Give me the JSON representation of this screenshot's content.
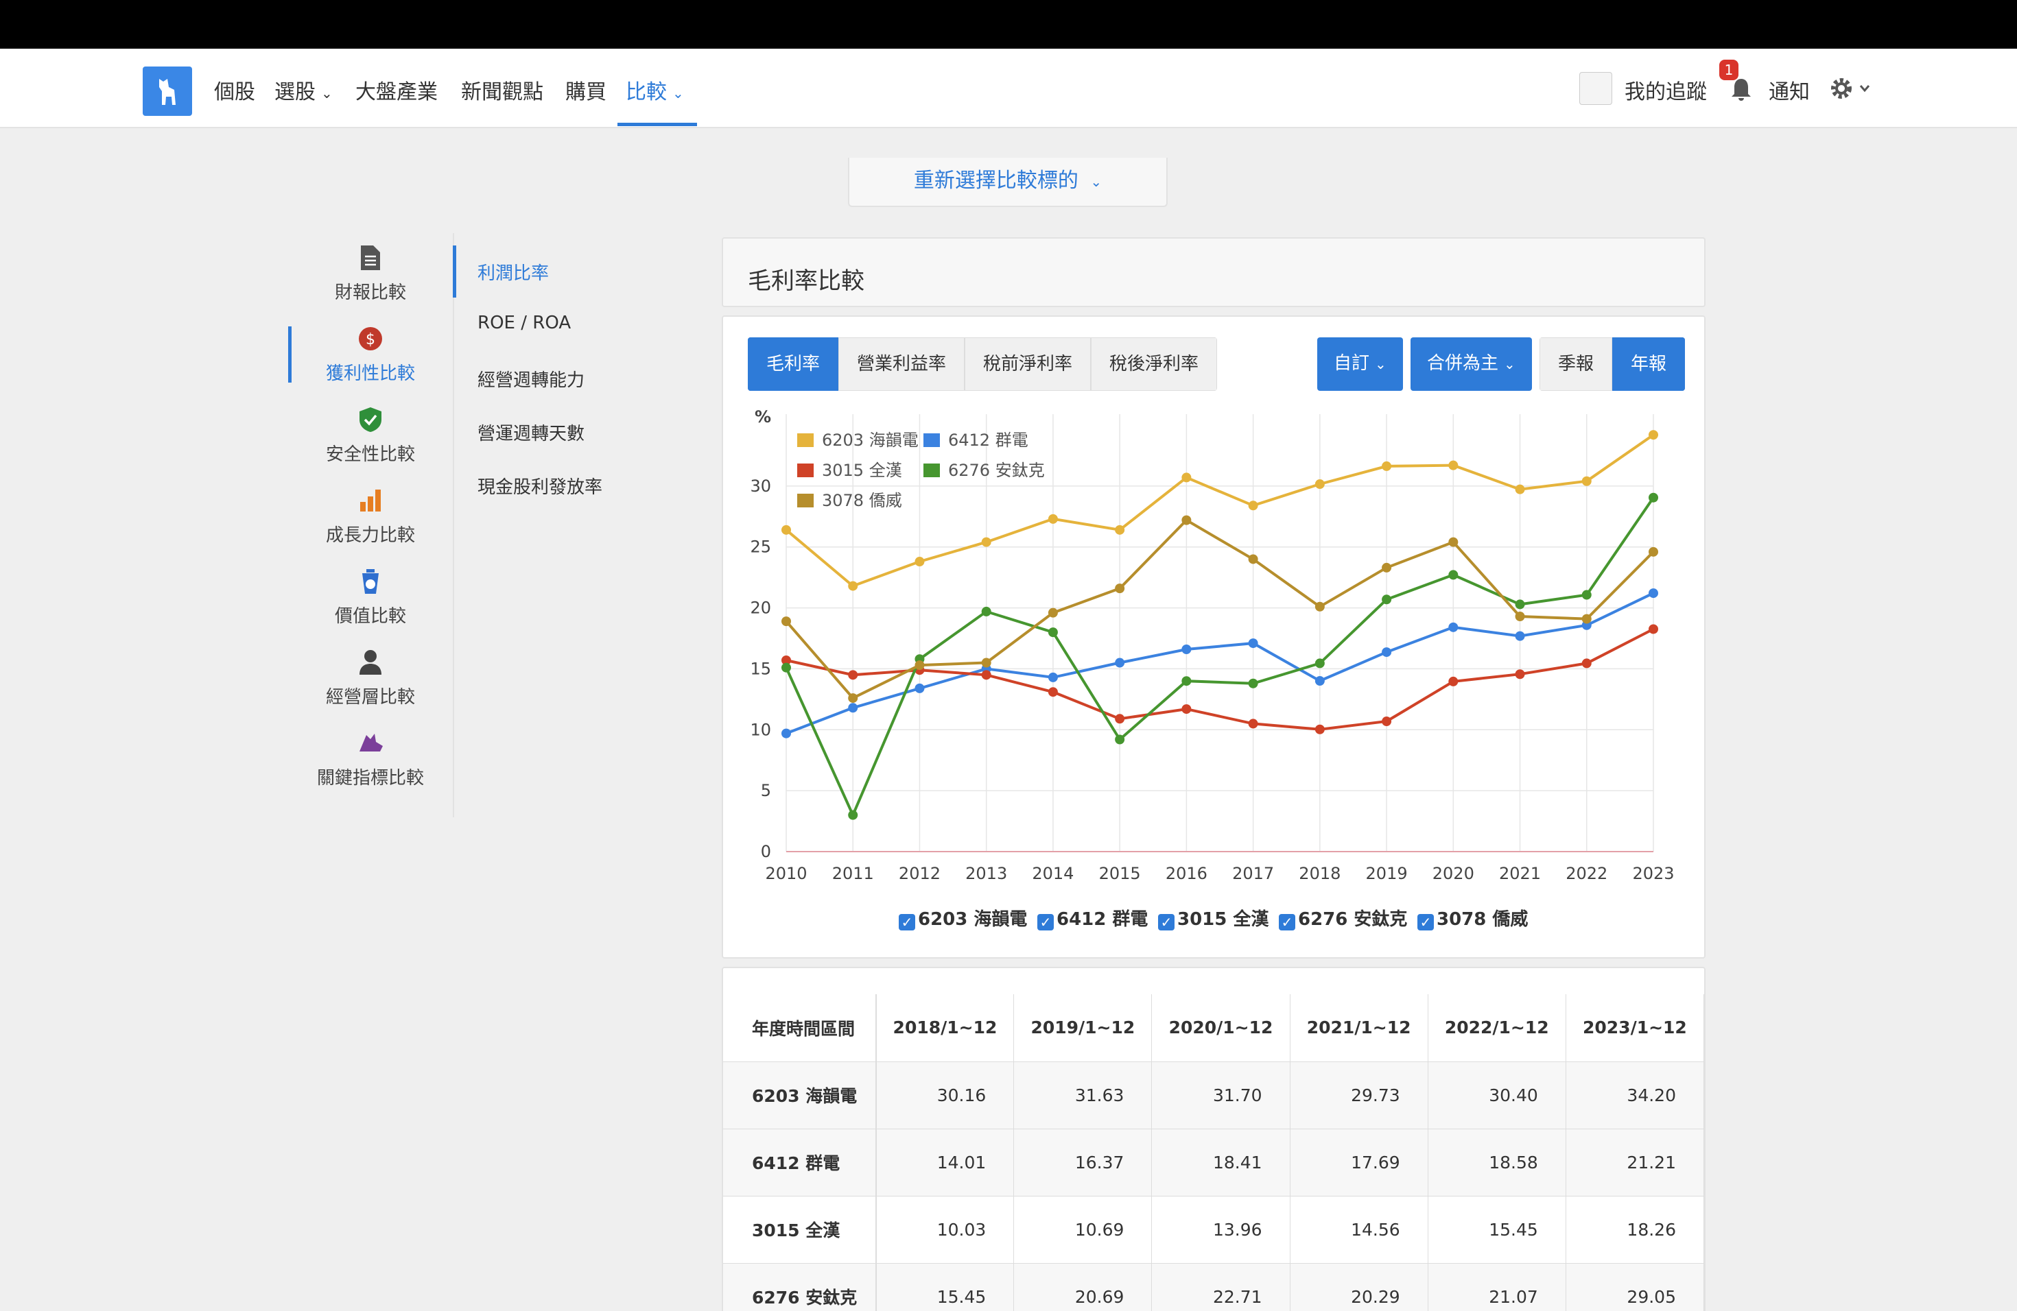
{
  "nav": {
    "items": [
      "個股",
      "選股",
      "大盤產業",
      "新聞觀點",
      "購買",
      "比較"
    ],
    "active": "比較",
    "my_tracking": "我的追蹤",
    "notifications": "通知",
    "notification_count": "1"
  },
  "reselect_label": "重新選擇比較標的",
  "side_nav": [
    "財報比較",
    "獲利性比較",
    "安全性比較",
    "成長力比較",
    "價值比較",
    "經營層比較",
    "關鍵指標比較"
  ],
  "side_nav_active": "獲利性比較",
  "sub_nav": [
    "利潤比率",
    "ROE / ROA",
    "經營週轉能力",
    "營運週轉天數",
    "現金股利發放率"
  ],
  "sub_nav_active": "利潤比率",
  "panel_title": "毛利率比較",
  "metric_tabs": [
    "毛利率",
    "營業利益率",
    "稅前淨利率",
    "稅後淨利率"
  ],
  "metric_active": "毛利率",
  "period_dropdown": "自訂",
  "basis_dropdown": "合併為主",
  "period_tabs": [
    "季報",
    "年報"
  ],
  "period_active": "年報",
  "colors": {
    "accent": "#2e7bd8",
    "s6203": "#e5b33b",
    "s6412": "#3b82e0",
    "s3015": "#cf4227",
    "s6276": "#46962f",
    "s3078": "#b68e2c"
  },
  "chart_data": {
    "type": "line",
    "ylabel": "%",
    "ylim": [
      0,
      35
    ],
    "yticks": [
      0,
      5,
      10,
      15,
      20,
      25,
      30
    ],
    "x": [
      "2010",
      "2011",
      "2012",
      "2013",
      "2014",
      "2015",
      "2016",
      "2017",
      "2018",
      "2019",
      "2020",
      "2021",
      "2022",
      "2023"
    ],
    "legend_position": "top-left",
    "grid": true,
    "series": [
      {
        "name": "6203 海韻電",
        "color": "#e5b33b",
        "values": [
          26.4,
          21.8,
          23.8,
          25.4,
          27.3,
          26.4,
          30.7,
          28.4,
          30.16,
          31.63,
          31.7,
          29.73,
          30.4,
          34.2
        ]
      },
      {
        "name": "6412 群電",
        "color": "#3b82e0",
        "values": [
          9.7,
          11.8,
          13.4,
          15.0,
          14.3,
          15.5,
          16.6,
          17.1,
          14.01,
          16.37,
          18.41,
          17.69,
          18.58,
          21.21
        ]
      },
      {
        "name": "3015 全漢",
        "color": "#cf4227",
        "values": [
          15.7,
          14.5,
          14.9,
          14.5,
          13.1,
          10.9,
          11.7,
          10.5,
          10.03,
          10.69,
          13.96,
          14.56,
          15.45,
          18.26
        ]
      },
      {
        "name": "6276 安鈦克",
        "color": "#46962f",
        "values": [
          15.1,
          3.0,
          15.8,
          19.7,
          18.0,
          9.2,
          14.0,
          13.8,
          15.45,
          20.69,
          22.71,
          20.29,
          21.07,
          29.05
        ]
      },
      {
        "name": "3078 僑威",
        "color": "#b68e2c",
        "values": [
          18.9,
          12.6,
          15.3,
          15.5,
          19.6,
          21.6,
          27.2,
          24.0,
          20.1,
          23.3,
          25.4,
          19.3,
          19.1,
          24.6
        ]
      }
    ]
  },
  "table": {
    "header_label": "年度時間區間",
    "columns": [
      "2018/1~12",
      "2019/1~12",
      "2020/1~12",
      "2021/1~12",
      "2022/1~12",
      "2023/1~12"
    ],
    "rows": [
      {
        "name": "6203 海韻電",
        "values": [
          "30.16",
          "31.63",
          "31.70",
          "29.73",
          "30.40",
          "34.20"
        ]
      },
      {
        "name": "6412 群電",
        "values": [
          "14.01",
          "16.37",
          "18.41",
          "17.69",
          "18.58",
          "21.21"
        ]
      },
      {
        "name": "3015 全漢",
        "values": [
          "10.03",
          "10.69",
          "13.96",
          "14.56",
          "15.45",
          "18.26"
        ]
      },
      {
        "name": "6276 安鈦克",
        "values": [
          "15.45",
          "20.69",
          "22.71",
          "20.29",
          "21.07",
          "29.05"
        ]
      }
    ]
  }
}
